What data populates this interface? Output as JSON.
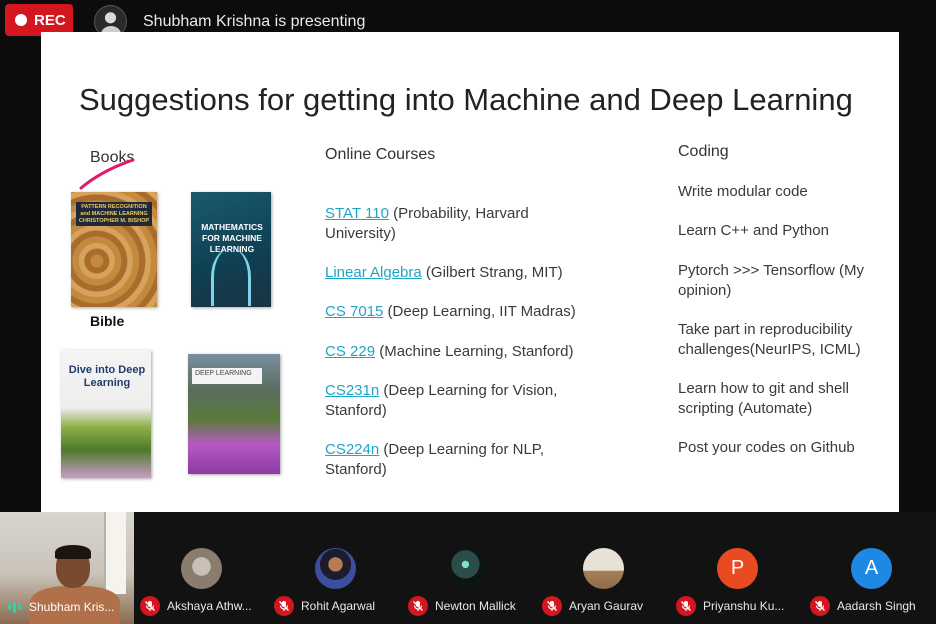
{
  "top_bar": {
    "rec_label": "REC",
    "presenter_text": "Shubham Krishna is presenting"
  },
  "slide": {
    "title": "Suggestions for getting into Machine and Deep Learning",
    "books": {
      "heading": "Books",
      "bible_label": "Bible",
      "covers": [
        {
          "title": "PATTERN RECOGNITION and MACHINE LEARNING CHRISTOPHER M. BISHOP"
        },
        {
          "title": "MATHEMATICS FOR MACHINE LEARNING"
        },
        {
          "title": "Dive into Deep Learning"
        },
        {
          "title": "DEEP LEARNING"
        }
      ]
    },
    "courses": {
      "heading": "Online Courses",
      "items": [
        {
          "link": "STAT 110",
          "rest": " (Probability, Harvard University)"
        },
        {
          "link": "Linear Algebra",
          "rest": " (Gilbert Strang, MIT)"
        },
        {
          "link": "CS 7015",
          "rest": " (Deep Learning, IIT Madras)"
        },
        {
          "link": "CS 229",
          "rest": " (Machine Learning, Stanford)"
        },
        {
          "link": "CS231n",
          "rest": " (Deep Learning for Vision, Stanford)"
        },
        {
          "link": "CS224n",
          "rest": " (Deep Learning for NLP, Stanford)"
        }
      ]
    },
    "coding": {
      "heading": "Coding",
      "items": [
        "Write modular code",
        "Learn C++ and Python",
        "Pytorch >>> Tensorflow (My opinion)",
        "Take part in reproducibility challenges(NeurIPS, ICML)",
        "Learn how to git and shell scripting (Automate)",
        "Post your codes on Github"
      ]
    }
  },
  "participants": {
    "self": {
      "name": "Shubham Kris..."
    },
    "others": [
      {
        "name": "Akshaya Athw...",
        "initial": "",
        "avatar_color": "#9a8f84"
      },
      {
        "name": "Rohit Agarwal",
        "initial": "",
        "avatar_color": "#3a4fa0"
      },
      {
        "name": "Newton Mallick",
        "initial": "",
        "avatar_color": "#1b2a2a"
      },
      {
        "name": "Aryan Gaurav",
        "initial": "",
        "avatar_color": "#c9b8a0"
      },
      {
        "name": "Priyanshu Ku...",
        "initial": "P",
        "avatar_color": "#ea4a1f"
      },
      {
        "name": "Aadarsh Singh",
        "initial": "A",
        "avatar_color": "#1e88e5"
      }
    ]
  },
  "colors": {
    "rec_red": "#d4161e",
    "link_blue": "#1fa5c8",
    "mic_off_red": "#d3161f",
    "speaking_green": "#2fd2a0"
  }
}
